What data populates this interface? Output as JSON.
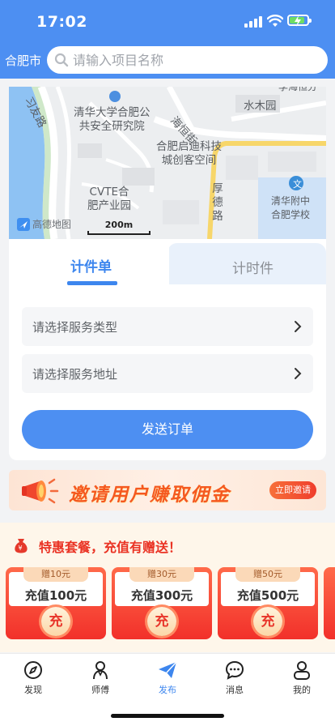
{
  "status_bar": {
    "time": "17:02"
  },
  "header": {
    "city": "合肥市",
    "search_placeholder": "请输入项目名称"
  },
  "map": {
    "labels": {
      "road_left": "习友路",
      "tsinghua_inst": "清华大学合肥公\n共安全研究院",
      "road_haiheng": "海恒街",
      "shuimuyuan": "水木园",
      "qidi": "合肥启迪科技\n城创客空间",
      "road_houde": "厚\n德\n路",
      "cvte": "CVTE合\n肥产业园",
      "school": "清华附中\n合肥学校",
      "top_right": "李海恒分"
    },
    "logo": "高德地图",
    "scale": "200m",
    "colors": {
      "water": "#8ec2f3",
      "road": "#ffffff",
      "highway": "#f7d66a",
      "green": "#cfe8c9"
    }
  },
  "order": {
    "tabs": [
      {
        "label": "计件单",
        "active": true
      },
      {
        "label": "计时件",
        "active": false
      }
    ],
    "service_type_placeholder": "请选择服务类型",
    "service_address_placeholder": "请选择服务地址",
    "send_label": "发送订单"
  },
  "banner": {
    "text": "邀请用户赚取佣金",
    "button": "立即邀请"
  },
  "packages": {
    "title": "特惠套餐，充值有赠送！",
    "items": [
      {
        "gift": "赠10元",
        "amount": "充值100元",
        "coin": "充"
      },
      {
        "gift": "赠30元",
        "amount": "充值300元",
        "coin": "充"
      },
      {
        "gift": "赠50元",
        "amount": "充值500元",
        "coin": "充"
      }
    ]
  },
  "nav": {
    "items": [
      {
        "label": "发现",
        "icon": "compass-icon"
      },
      {
        "label": "师傅",
        "icon": "worker-icon"
      },
      {
        "label": "发布",
        "icon": "paper-plane-icon",
        "active": true
      },
      {
        "label": "消息",
        "icon": "chat-icon"
      },
      {
        "label": "我的",
        "icon": "user-icon"
      }
    ]
  },
  "theme": {
    "primary": "#4d8ff2",
    "accent_red": "#ea3324"
  }
}
